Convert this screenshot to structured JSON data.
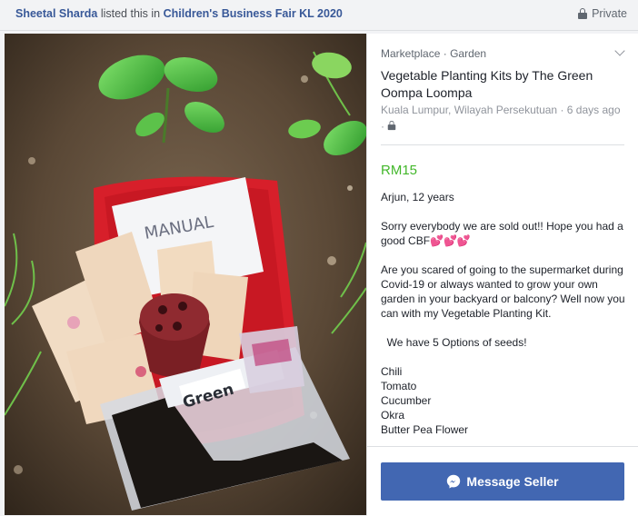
{
  "header": {
    "seller_name": "Sheetal Sharda",
    "listed_text": "listed this in",
    "group_name": "Children's Business Fair KL 2020",
    "privacy_label": "Private"
  },
  "listing": {
    "breadcrumb_root": "Marketplace",
    "breadcrumb_sep": "·",
    "breadcrumb_category": "Garden",
    "title": "Vegetable Planting Kits by The Green Oompa Loompa",
    "location": "Kuala Lumpur, Wilayah Persekutuan",
    "posted": "6 days ago",
    "price": "RM15",
    "seller_line": "Arjun, 12 years",
    "sold_out_text": "Sorry everybody we are sold out!!  Hope you had a good CBF",
    "hearts": "💕💕💕",
    "pitch": "Are you scared of going to the supermarket during Covid-19 or always wanted to grow your own garden in your backyard or balcony? Well now you can with my Vegetable Planting Kit.",
    "options_heading": "We have 5 Options of seeds!",
    "seeds": [
      "Chili",
      "Tomato",
      "Cucumber",
      "Okra",
      "Butter Pea Flower"
    ]
  },
  "photo": {
    "manual_text": "MANUAL",
    "bag_text": "Green"
  },
  "actions": {
    "message_seller_label": "Message Seller"
  },
  "colors": {
    "link": "#385898",
    "price": "#42b72a",
    "button": "#4267b2"
  }
}
